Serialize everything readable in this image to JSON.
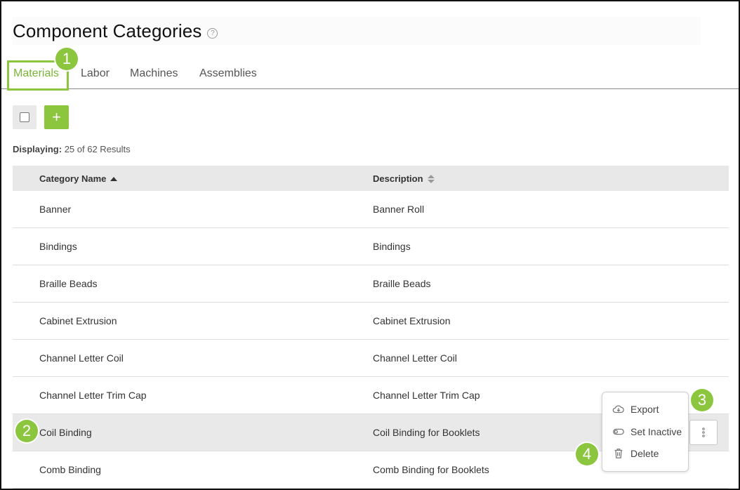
{
  "page": {
    "title": "Component Categories",
    "help_icon": "?"
  },
  "tabs": [
    {
      "label": "Materials",
      "active": true
    },
    {
      "label": "Labor",
      "active": false
    },
    {
      "label": "Machines",
      "active": false
    },
    {
      "label": "Assemblies",
      "active": false
    }
  ],
  "toolbar": {
    "add_label": "+"
  },
  "results": {
    "prefix": "Displaying:",
    "text": "25 of 62 Results"
  },
  "table": {
    "columns": [
      "Category Name",
      "Description"
    ],
    "rows": [
      {
        "name": "Banner",
        "description": "Banner Roll"
      },
      {
        "name": "Bindings",
        "description": "Bindings"
      },
      {
        "name": "Braille Beads",
        "description": "Braille Beads"
      },
      {
        "name": "Cabinet Extrusion",
        "description": "Cabinet Extrusion"
      },
      {
        "name": "Channel Letter Coil",
        "description": "Channel Letter Coil"
      },
      {
        "name": "Channel Letter Trim Cap",
        "description": "Channel Letter Trim Cap"
      },
      {
        "name": "Coil Binding",
        "description": "Coil Binding for Booklets"
      },
      {
        "name": "Comb Binding",
        "description": "Comb Binding for Booklets"
      }
    ]
  },
  "menu": {
    "items": [
      "Export",
      "Set Inactive",
      "Delete"
    ]
  },
  "callouts": [
    "1",
    "2",
    "3",
    "4"
  ],
  "colors": {
    "accent": "#8cc63f",
    "active_tab_text": "#7ab538"
  }
}
